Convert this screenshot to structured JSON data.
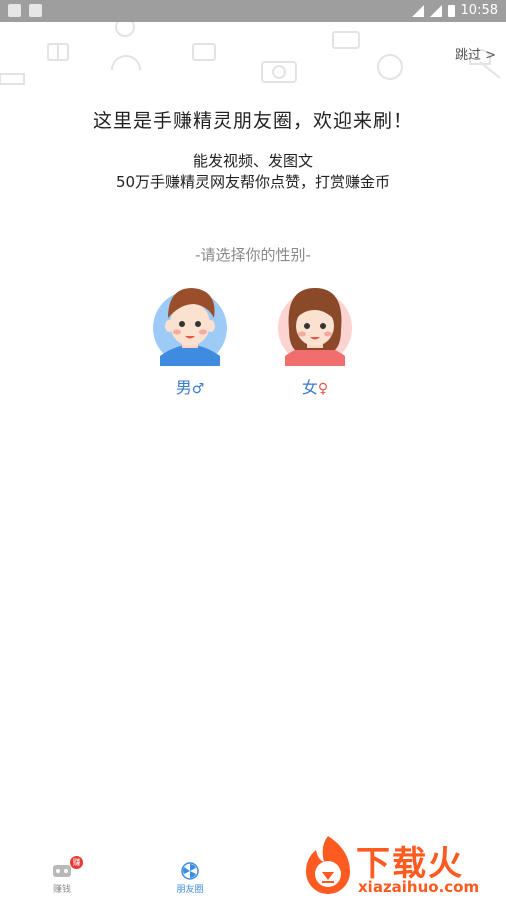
{
  "status_bar": {
    "time": "10:58"
  },
  "skip_label": "跳过 >",
  "headline": "这里是手赚精灵朋友圈，欢迎来刷！",
  "subline1": "能发视频、发图文",
  "subline2": "50万手赚精灵网友帮你点赞，打赏赚金币",
  "gender_prompt": "-请选择你的性别-",
  "male": {
    "label": "男",
    "symbol": "♂"
  },
  "female": {
    "label": "女",
    "symbol": "♀"
  },
  "tabs": [
    {
      "label": "赚钱",
      "badge": "赚",
      "icon": "game-icon"
    },
    {
      "label": "朋友圈",
      "icon": "pinwheel-icon"
    }
  ],
  "watermark": {
    "text": "下载火",
    "url": "xiazaihuo.com"
  },
  "colors": {
    "accent": "#3b8de0",
    "badge": "#e53935",
    "watermark": "#ff5a1f"
  }
}
